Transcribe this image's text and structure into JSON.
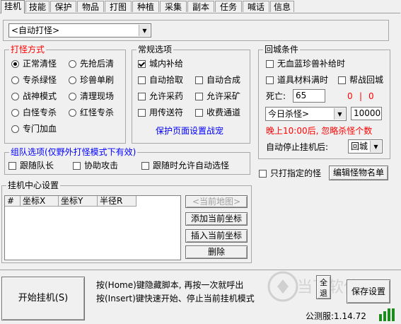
{
  "tabs": [
    "挂机",
    "技能",
    "保护",
    "物品",
    "打图",
    "种植",
    "采集",
    "副本",
    "任务",
    "喊话",
    "信息"
  ],
  "mode_select": "<自动打怪>",
  "fight_mode": {
    "title": "打怪方式",
    "options": [
      "正常清怪",
      "先抢后清",
      "专杀绿怪",
      "珍兽单刷",
      "战神模式",
      "清理现场",
      "白怪专杀",
      "红怪专杀",
      "专门加血"
    ]
  },
  "general": {
    "title": "常规选项",
    "options": [
      "城内补给",
      "自动拾取",
      "自动合成",
      "允许采药",
      "允许采矿",
      "用传送符",
      "收费通道"
    ],
    "link": "保护页面设置战宠"
  },
  "return_city": {
    "title": "回城条件",
    "opt1": "无血蓝珍兽补给时",
    "opt2": "道具材料满时",
    "opt3": "帮战回城",
    "death_label": "死亡:",
    "death_value": "65",
    "count_a": "0",
    "count_sep": "|",
    "count_b": "0",
    "kill_select": "今日杀怪>",
    "kill_value": "10000",
    "notice": "晚上10:00后, 忽略杀怪个数",
    "after_label": "自动停止挂机后:",
    "after_select": "回城"
  },
  "team": {
    "title": "组队选项(仅野外打怪模式下有效)",
    "options": [
      "跟随队长",
      "协助攻击",
      "跟随时允许自动选怪"
    ]
  },
  "only_specified": "只打指定的怪",
  "edit_monster_btn": "编辑怪物名单",
  "center": {
    "title": "挂机中心设置",
    "columns": [
      "#",
      "坐标X",
      "坐标Y",
      "半径R"
    ],
    "btn_current_map": "<当前地图>",
    "btn_add": "添加当前坐标",
    "btn_insert": "插入当前坐标",
    "btn_delete": "删除"
  },
  "bottom": {
    "start_btn": "开始挂机(S)",
    "hint1": "按(Home)键隐藏脚本, 再按一次就呼出",
    "hint2": "按(Insert)键快速开始、停止当前挂机模式",
    "quit_btn": "全退",
    "save_btn": "保存设置",
    "version": "公测服:1.14.72"
  },
  "watermark": "当下软件园"
}
